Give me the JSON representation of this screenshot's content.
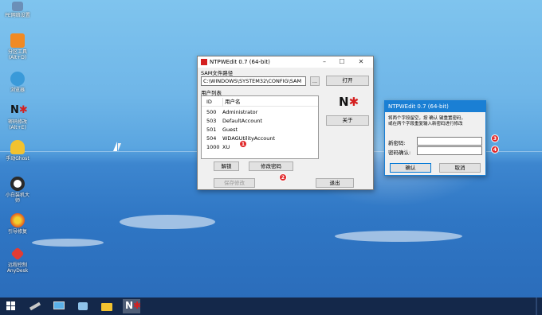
{
  "desktop": {
    "icons": [
      {
        "label": "PE网络设置",
        "icon": "network-settings-icon",
        "color": "#6b8fb8"
      },
      {
        "label": "分区工具\n(Alt+D)",
        "icon": "partition-tool-icon",
        "color": "#f08a24"
      },
      {
        "label": "浏览器",
        "icon": "browser-icon",
        "color": "#3a9ad9"
      },
      {
        "label": "密码修改\n(Alt+E)",
        "icon": "password-tool-icon",
        "color": "#1a1a1a"
      },
      {
        "label": "手动Ghost",
        "icon": "ghost-icon",
        "color": "#f2c230"
      },
      {
        "label": "小白装机大\n师",
        "icon": "installer-icon",
        "color": "#2a2a2a"
      },
      {
        "label": "引导修复",
        "icon": "boot-repair-icon",
        "color": "#e8a020"
      },
      {
        "label": "远程控制\nAnyDesk",
        "icon": "anydesk-icon",
        "color": "#e23c33"
      }
    ]
  },
  "ntpw": {
    "title": "NTPWEdit 0.7 (64-bit)",
    "sam_label": "SAM文件路径",
    "sam_path": "C:\\WINDOWS\\SYSTEM32\\CONFIG\\SAM",
    "browse_label": "...",
    "open_label": "打开",
    "users_label": "用户列表",
    "col_id": "ID",
    "col_name": "用户名",
    "users": [
      {
        "id": "500",
        "name": "Administrator"
      },
      {
        "id": "503",
        "name": "DefaultAccount"
      },
      {
        "id": "501",
        "name": "Guest"
      },
      {
        "id": "504",
        "name": "WDAGUtilityAccount"
      },
      {
        "id": "1000",
        "name": "XU"
      }
    ],
    "unlock_label": "解锁",
    "change_pwd_label": "修改密码",
    "save_label": "保存修改",
    "about_label": "关于",
    "exit_label": "退出"
  },
  "dialog": {
    "title": "NTPWEdit 0.7 (64-bit)",
    "instruction": "将两个字段留空，按 确认 键重置密码，\n或在两个字段重复输入新密码进行修改",
    "new_pwd_label": "新密码:",
    "confirm_pwd_label": "密码确认:",
    "ok_label": "确认",
    "cancel_label": "取消"
  },
  "markers": [
    "1",
    "2",
    "3",
    "4"
  ],
  "colors": {
    "accent": "#1a7fd4",
    "marker": "#e0282a",
    "taskbar": "#14284a"
  }
}
